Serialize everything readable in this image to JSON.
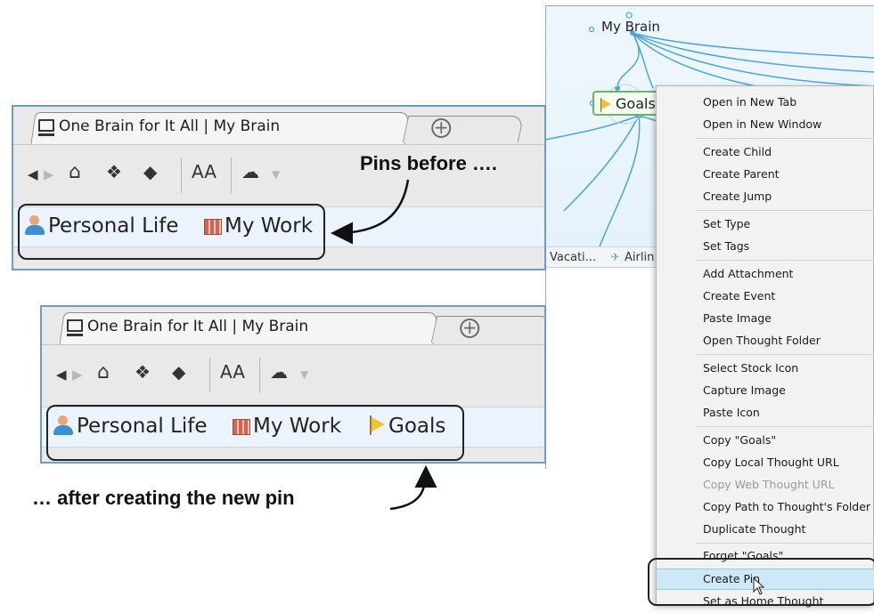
{
  "brain": {
    "node_mybrain": "My Brain",
    "node_goals": "Goals",
    "strip_items": [
      "Vacati...",
      "Airlin"
    ]
  },
  "context_menu": {
    "items": [
      {
        "label": "Open in New Tab"
      },
      {
        "label": "Open in New Window"
      },
      {
        "label": "Create Child"
      },
      {
        "label": "Create Parent"
      },
      {
        "label": "Create Jump"
      },
      {
        "label": "Set Type"
      },
      {
        "label": "Set Tags"
      },
      {
        "label": "Add Attachment"
      },
      {
        "label": "Create Event"
      },
      {
        "label": "Paste Image"
      },
      {
        "label": "Open Thought Folder"
      },
      {
        "label": "Select Stock Icon"
      },
      {
        "label": "Capture Image"
      },
      {
        "label": "Paste Icon"
      },
      {
        "label": "Copy \"Goals\""
      },
      {
        "label": "Copy Local Thought URL"
      },
      {
        "label": "Copy Web Thought URL",
        "disabled": true
      },
      {
        "label": "Copy Path to Thought's Folder"
      },
      {
        "label": "Duplicate Thought"
      },
      {
        "label": "Forget \"Goals\""
      },
      {
        "label": "Create Pin",
        "highlighted": true
      },
      {
        "label": "Set as Home Thought"
      }
    ]
  },
  "window_before": {
    "tab_title": "One Brain for It All | My Brain",
    "pins": [
      "Personal Life",
      "My Work"
    ]
  },
  "window_after": {
    "tab_title": "One Brain for It All | My Brain",
    "pins": [
      "Personal Life",
      "My Work",
      "Goals"
    ]
  },
  "toolbar": {
    "icons": [
      "back-icon",
      "forward-icon",
      "home-icon",
      "map-icon",
      "tag-icon",
      "font-size-icon",
      "cloud-icon",
      "chevron-down-icon"
    ],
    "font_label": "AA"
  },
  "captions": {
    "before": "Pins before ….",
    "after": "… after creating the new pin"
  },
  "colors": {
    "window_border": "#6e9cc9",
    "pinbar_bg": "#ebf4fc",
    "menu_highlight": "#cde8f7",
    "link_lines": "#4aa7d6",
    "goals_border": "#6db36a"
  }
}
